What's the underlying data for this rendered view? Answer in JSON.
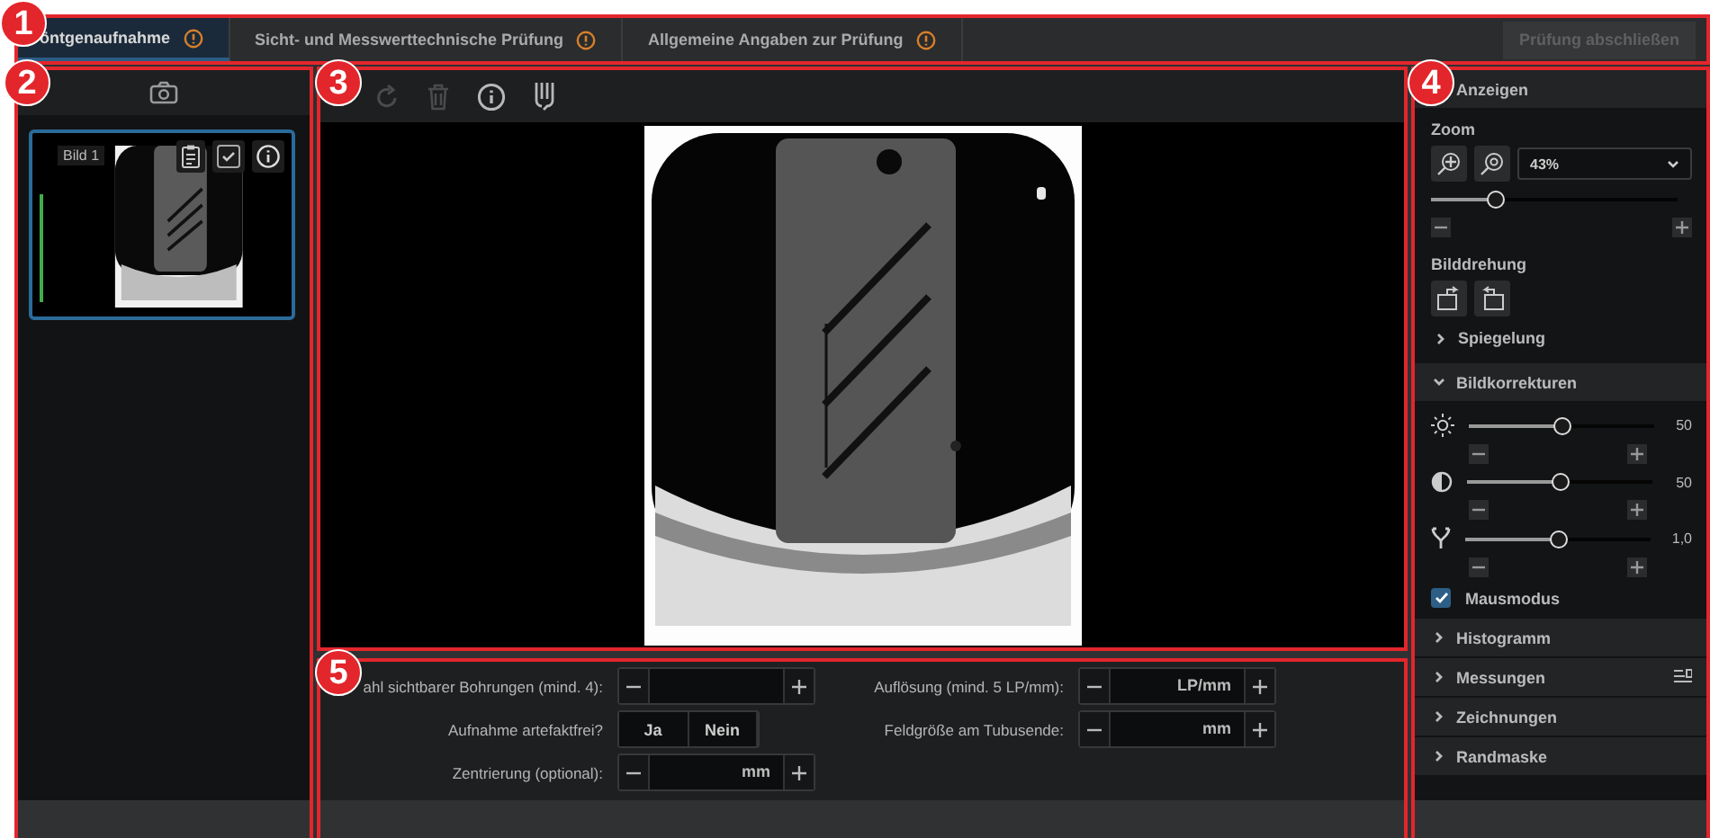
{
  "annotations": [
    {
      "number": "1"
    },
    {
      "number": "2"
    },
    {
      "number": "3"
    },
    {
      "number": "4"
    },
    {
      "number": "5"
    }
  ],
  "tabs": [
    {
      "label": "öntgenaufnahme",
      "selected": true,
      "warning": true
    },
    {
      "label": "Sicht- und Messwerttechnische Prüfung",
      "selected": false,
      "warning": true
    },
    {
      "label": "Allgemeine Angaben zur Prüfung",
      "selected": false,
      "warning": true
    }
  ],
  "finish_button": {
    "label": "Prüfung abschließen",
    "disabled": true
  },
  "thumbnails": [
    {
      "label": "Bild 1",
      "selected": true
    }
  ],
  "viewer_toolbar": [
    {
      "kind": "rotate",
      "disabled": true
    },
    {
      "kind": "delete",
      "disabled": true
    },
    {
      "kind": "info",
      "disabled": false
    },
    {
      "kind": "clip",
      "disabled": false
    }
  ],
  "form": {
    "rows": [
      [
        {
          "kind": "stepper",
          "label": "ahl sichtbarer Bohrungen (mind. 4):"
        },
        {
          "kind": "stepper",
          "label": "Auflösung (mind. 5 LP/mm):",
          "unit": "LP/mm"
        }
      ],
      [
        {
          "kind": "toggle",
          "label": "Aufnahme artefaktfrei?",
          "options": [
            {
              "label": "Ja",
              "selected": false
            },
            {
              "label": "Nein",
              "selected": false
            }
          ]
        },
        {
          "kind": "stepper",
          "label": "Feldgröße am Tubusende:",
          "unit": "mm"
        }
      ],
      [
        {
          "kind": "stepper",
          "label": "Zentrierung (optional):",
          "unit": "mm"
        }
      ]
    ]
  },
  "side_panel": {
    "sections": [
      {
        "kind": "display",
        "title": "Anzeigen",
        "zoom_label": "Zoom",
        "zoom_value": "43%",
        "zoom_slider": {
          "level": 0.26
        },
        "rotation_label": "Bilddrehung",
        "mirror": {
          "title": "Spiegelung",
          "expanded": false
        }
      },
      {
        "kind": "corrections",
        "title": "Bildkorrekturen",
        "expanded": true,
        "sliders": [
          {
            "kind": "brightness",
            "level": 0.5,
            "reading": "50"
          },
          {
            "kind": "contrast",
            "level": 0.5,
            "reading": "50"
          },
          {
            "kind": "gamma",
            "level": 0.5,
            "reading": "1,0"
          }
        ],
        "mouse_mode": {
          "label": "Mausmodus",
          "checked": true
        }
      },
      {
        "kind": "plain",
        "title": "Histogramm",
        "expanded": false
      },
      {
        "kind": "plain",
        "title": "Messungen",
        "expanded": false,
        "tool_icon": true
      },
      {
        "kind": "plain",
        "title": "Zeichnungen",
        "expanded": false
      },
      {
        "kind": "plain",
        "title": "Randmaske",
        "expanded": false
      }
    ]
  }
}
